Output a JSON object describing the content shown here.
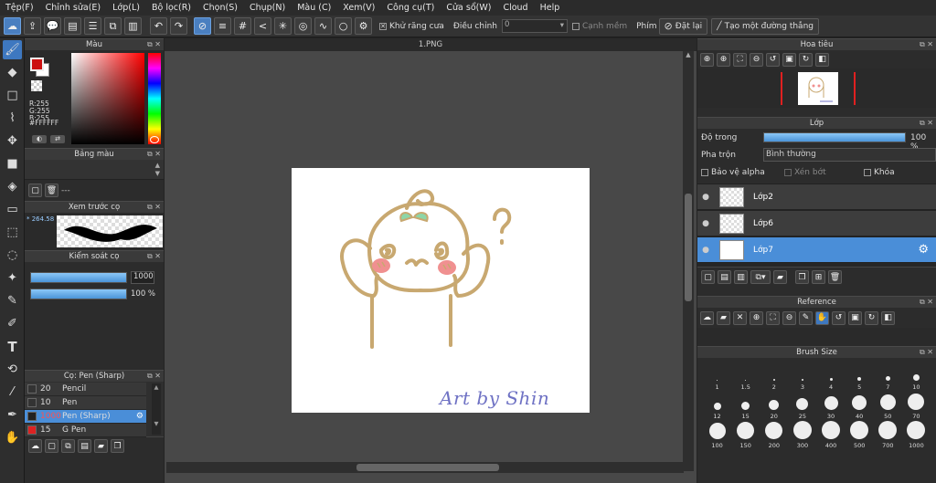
{
  "menu": [
    "Tệp(F)",
    "Chỉnh sửa(E)",
    "Lớp(L)",
    "Bộ lọc(R)",
    "Chọn(S)",
    "Chụp(N)",
    "Màu (C)",
    "Xem(V)",
    "Công cụ(T)",
    "Cửa sổ(W)",
    "Cloud",
    "Help"
  ],
  "toolbar": {
    "antialias": "Khử răng cưa",
    "adjust": "Điều chỉnh",
    "adjust_value": "0",
    "edge": "Cạnh mềm",
    "key": "Phím",
    "reset": "Đặt lại",
    "create_line": "Tạo một đường thẳng"
  },
  "color_panel": {
    "title": "Màu",
    "r": "R:255",
    "g": "G:255",
    "b": "B:255",
    "hex": "#FFFFFF",
    "primary_color": "#cc1111",
    "secondary_color": "#ffffff"
  },
  "palette_panel": {
    "title": "Bảng màu",
    "value": "---"
  },
  "preview_panel": {
    "title": "Xem trước cọ",
    "size": "* 264.58"
  },
  "brush_control": {
    "title": "Kiểm soát cọ",
    "size": "1000",
    "opacity": "100 %",
    "size_fraction": 1.0,
    "opacity_fraction": 1.0
  },
  "brush_panel": {
    "title": "Cọ: Pen (Sharp)",
    "brushes": [
      {
        "size": "20",
        "name": "Pencil",
        "selected": false,
        "color": "#333333"
      },
      {
        "size": "10",
        "name": "Pen",
        "selected": false,
        "color": "#333333"
      },
      {
        "size": "1000",
        "name": "Pen (Sharp)",
        "selected": true,
        "color": "#222222"
      },
      {
        "size": "15",
        "name": "G Pen",
        "selected": false,
        "color": "#dd2222"
      }
    ]
  },
  "canvas": {
    "tab": "1.PNG",
    "signature": "Art by Shin"
  },
  "navigator": {
    "title": "Hoa tiêu"
  },
  "layer_panel": {
    "title": "Lớp",
    "opacity_label": "Độ trong",
    "opacity_value": "100 %",
    "opacity_fraction": 1.0,
    "blend_label": "Pha trộn",
    "blend_value": "Bình thường",
    "protect_alpha": "Bảo vệ alpha",
    "clipping": "Xén bớt",
    "lock": "Khóa",
    "layers": [
      {
        "name": "Lớp2",
        "selected": false
      },
      {
        "name": "Lớp6",
        "selected": false
      },
      {
        "name": "Lớp7",
        "selected": true
      }
    ]
  },
  "reference_panel": {
    "title": "Reference"
  },
  "brush_size_panel": {
    "title": "Brush Size",
    "rows": [
      [
        {
          "v": "1",
          "d": 1
        },
        {
          "v": "1.5",
          "d": 1.5
        },
        {
          "v": "2",
          "d": 2
        },
        {
          "v": "3",
          "d": 2.5
        },
        {
          "v": "4",
          "d": 3
        },
        {
          "v": "5",
          "d": 4
        },
        {
          "v": "7",
          "d": 5
        },
        {
          "v": "10",
          "d": 7
        }
      ],
      [
        {
          "v": "12",
          "d": 8
        },
        {
          "v": "15",
          "d": 9
        },
        {
          "v": "20",
          "d": 11
        },
        {
          "v": "25",
          "d": 13
        },
        {
          "v": "30",
          "d": 15
        },
        {
          "v": "40",
          "d": 16
        },
        {
          "v": "50",
          "d": 17
        },
        {
          "v": "70",
          "d": 18
        }
      ],
      [
        {
          "v": "100",
          "d": 18
        },
        {
          "v": "150",
          "d": 19
        },
        {
          "v": "200",
          "d": 19
        },
        {
          "v": "300",
          "d": 20
        },
        {
          "v": "400",
          "d": 20
        },
        {
          "v": "500",
          "d": 20
        },
        {
          "v": "700",
          "d": 20
        },
        {
          "v": "1000",
          "d": 20
        }
      ]
    ]
  }
}
